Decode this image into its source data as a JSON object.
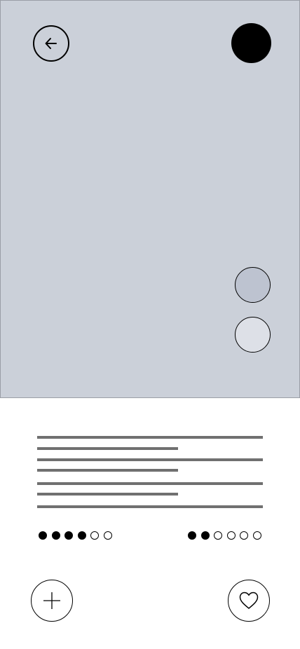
{
  "colors": {
    "hero_background": "#cbd0d9",
    "avatar": "#000000",
    "swatch_1": "#bdc3d0",
    "swatch_2": "#dde0e7",
    "text_placeholder": "#707070",
    "dot_filled": "#000000",
    "dot_empty": "#ffffff"
  },
  "icons": {
    "back": "arrow-left-icon",
    "add": "plus-icon",
    "like": "heart-icon"
  },
  "rating_left": {
    "filled": 4,
    "total": 6
  },
  "rating_right": {
    "filled": 2,
    "total": 6
  }
}
